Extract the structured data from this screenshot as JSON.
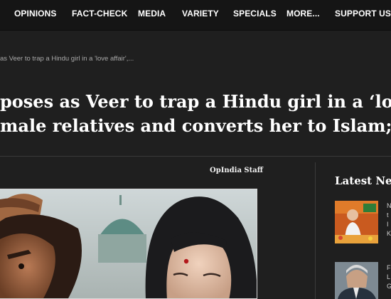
{
  "nav": {
    "items": [
      {
        "label": "OPINIONS"
      },
      {
        "label": "FACT-CHECK"
      },
      {
        "label": "MEDIA"
      },
      {
        "label": "VARIETY"
      },
      {
        "label": "SPECIALS"
      },
      {
        "label": "MORE..."
      },
      {
        "label": "SUPPORT US"
      }
    ]
  },
  "breadcrumb": "as Veer to trap a Hindu girl in a 'love affair',...",
  "headline": {
    "line1": "poses as Veer to trap a Hindu girl in a ‘love",
    "line2": "male relatives and converts her to Islam;"
  },
  "article": {
    "author": "OpIndia Staff"
  },
  "sidebar": {
    "title": "Latest New",
    "items": [
      {
        "text_fragments": [
          "N",
          "t",
          "I",
          "K"
        ]
      },
      {
        "text_fragments": [
          "F",
          "L",
          "G"
        ]
      }
    ]
  }
}
